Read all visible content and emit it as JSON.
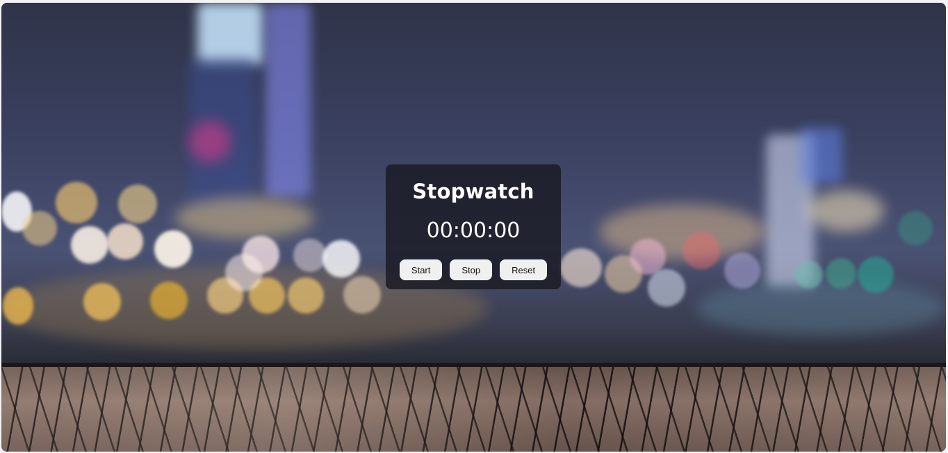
{
  "stopwatch": {
    "title": "Stopwatch",
    "time": "00:00:00",
    "buttons": {
      "start": "Start",
      "stop": "Stop",
      "reset": "Reset"
    }
  },
  "colors": {
    "panel_bg": "#1a1a22",
    "button_bg": "#f0f0f0",
    "text": "#ffffff"
  }
}
